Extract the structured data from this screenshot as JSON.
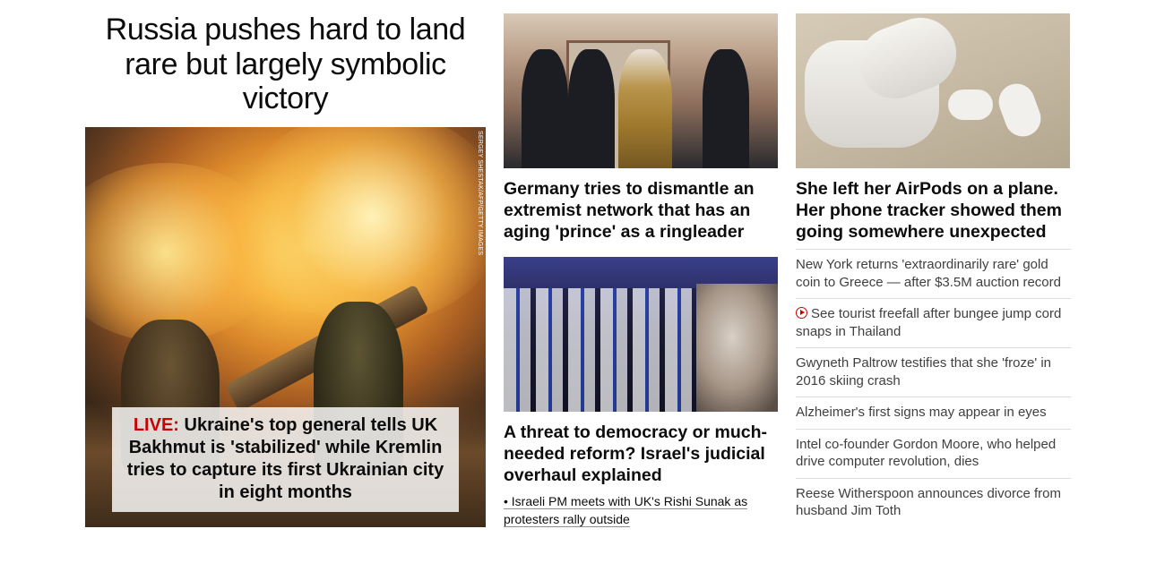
{
  "main_story": {
    "headline": "Russia pushes hard to land rare but largely symbolic victory",
    "image_credit": "SERGEY SHESTAK/AFP/GETTY IMAGES",
    "caption_live": "LIVE:",
    "caption_text": " Ukraine's top general tells UK Bakhmut is 'stabilized' while Kremlin tries to capture its first Ukrainian city in eight months"
  },
  "middle_column": {
    "story1": {
      "title": "Germany tries to dismantle an extremist network that has an aging 'prince' as a ringleader"
    },
    "story2": {
      "title": "A threat to democracy or much-needed reform? Israel's judicial overhaul explained",
      "related_link": "• Israeli PM meets with UK's Rishi Sunak as protesters rally outside"
    }
  },
  "right_column": {
    "feature_title": "She left her AirPods on a plane. Her phone tracker showed them going somewhere unexpected",
    "list": [
      {
        "text": "New York returns 'extraordinarily rare' gold coin to Greece — after $3.5M auction record",
        "icon": null
      },
      {
        "text": "See tourist freefall after bungee jump cord snaps in Thailand",
        "icon": "play-circle-icon"
      },
      {
        "text": "Gwyneth Paltrow testifies that she 'froze' in 2016 skiing crash",
        "icon": null
      },
      {
        "text": "Alzheimer's first signs may appear in eyes",
        "icon": null
      },
      {
        "text": "Intel co-founder Gordon Moore, who helped drive computer revolution, dies",
        "icon": null
      },
      {
        "text": "Reese Witherspoon announces divorce from husband Jim Toth",
        "icon": null
      }
    ]
  },
  "colors": {
    "live_red": "#cc0000",
    "text": "#0c0c0c",
    "secondary_text": "#404040",
    "divider": "#dddddd"
  }
}
